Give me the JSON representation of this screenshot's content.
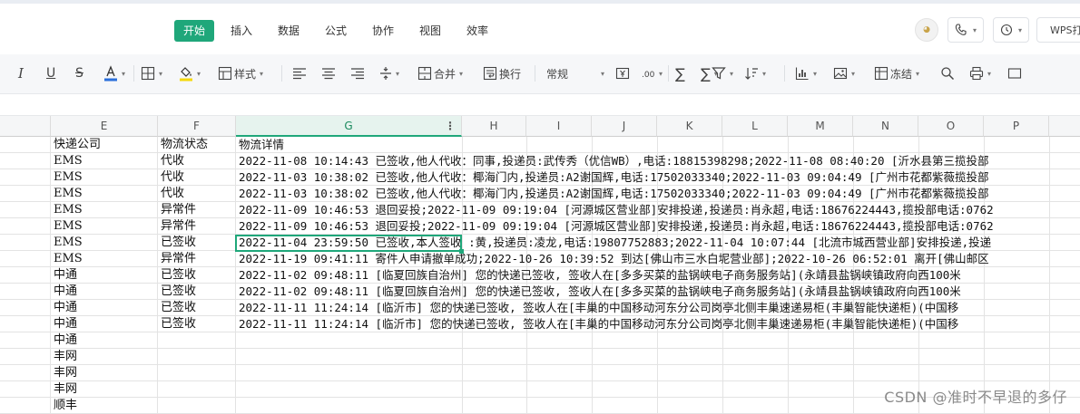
{
  "ribbon": {
    "tabs": [
      {
        "label": "开始",
        "active": true
      },
      {
        "label": "插入",
        "active": false
      },
      {
        "label": "数据",
        "active": false
      },
      {
        "label": "公式",
        "active": false
      },
      {
        "label": "协作",
        "active": false
      },
      {
        "label": "视图",
        "active": false
      },
      {
        "label": "效率",
        "active": false
      }
    ],
    "right_button_label": "WPS打",
    "accent_color": "#1fa77a"
  },
  "toolbar": {
    "style_label": "样式",
    "merge_label": "合并",
    "wrap_label": "换行",
    "number_format_value": "常规",
    "freeze_label": "冻结",
    "font_color": "#2a6fdb",
    "fill_color": "#f5d90a"
  },
  "grid": {
    "columns": [
      "E",
      "F",
      "G",
      "H",
      "I",
      "J",
      "K",
      "L",
      "M",
      "N",
      "O",
      "P"
    ],
    "selected_column": "G",
    "rows": [
      {
        "e": "快递公司",
        "f": "物流状态",
        "g": "物流详情"
      },
      {
        "e": "EMS",
        "f": "代收",
        "g": "2022-11-08 10:14:43 已签收,他人代收：同事,投递员:武传秀（优信WB）,电话:18815398298;2022-11-08 08:40:20 [沂水县第三揽投部"
      },
      {
        "e": "EMS",
        "f": "代收",
        "g": "2022-11-03 10:38:02 已签收,他人代收：椰海门内,投递员:A2谢国辉,电话:17502033340;2022-11-03 09:04:49 [广州市花都紫薇揽投部"
      },
      {
        "e": "EMS",
        "f": "代收",
        "g": "2022-11-03 10:38:02 已签收,他人代收：椰海门内,投递员:A2谢国辉,电话:17502033340;2022-11-03 09:04:49 [广州市花都紫薇揽投部"
      },
      {
        "e": "EMS",
        "f": "异常件",
        "g": "2022-11-09 10:46:53 退回妥投;2022-11-09 09:19:04 [河源城区营业部]安排投递,投递员:肖永超,电话:18676224443,揽投部电话:0762"
      },
      {
        "e": "EMS",
        "f": "异常件",
        "g": "2022-11-09 10:46:53 退回妥投;2022-11-09 09:19:04 [河源城区营业部]安排投递,投递员:肖永超,电话:18676224443,揽投部电话:0762"
      },
      {
        "e": "EMS",
        "f": "已签收",
        "g": "2022-11-04 23:59:50 已签收,本人签收 :黄,投递员:凌龙,电话:19807752883;2022-11-04 10:07:44 [北流市城西营业部]安排投递,投递"
      },
      {
        "e": "EMS",
        "f": "异常件",
        "g": "2022-11-19 09:41:11 寄件人申请撤单成功;2022-10-26 10:39:52 到达[佛山市三水白坭营业部];2022-10-26 06:52:01 离开[佛山邮区"
      },
      {
        "e": "中通",
        "f": "已签收",
        "g": "2022-11-02 09:48:11 [临夏回族自治州] 您的快递已签收, 签收人在[多多买菜的盐锅峡电子商务服务站](永靖县盐锅峡镇政府向西100米"
      },
      {
        "e": "中通",
        "f": "已签收",
        "g": "2022-11-02 09:48:11 [临夏回族自治州] 您的快递已签收, 签收人在[多多买菜的盐锅峡电子商务服务站](永靖县盐锅峡镇政府向西100米"
      },
      {
        "e": "中通",
        "f": "已签收",
        "g": "2022-11-11 11:24:14 [临沂市] 您的快递已签收, 签收人在[丰巢的中国移动河东分公司岗亭北侧丰巢速递易柜(丰巢智能快递柜)(中国移"
      },
      {
        "e": "中通",
        "f": "已签收",
        "g": "2022-11-11 11:24:14 [临沂市] 您的快递已签收, 签收人在[丰巢的中国移动河东分公司岗亭北侧丰巢速递易柜(丰巢智能快递柜)(中国移"
      },
      {
        "e": "中通",
        "f": "",
        "g": ""
      },
      {
        "e": "丰网",
        "f": "",
        "g": ""
      },
      {
        "e": "丰网",
        "f": "",
        "g": ""
      },
      {
        "e": "丰网",
        "f": "",
        "g": ""
      },
      {
        "e": "顺丰",
        "f": "",
        "g": ""
      }
    ]
  },
  "watermark": "CSDN @准时不早退的多仔"
}
